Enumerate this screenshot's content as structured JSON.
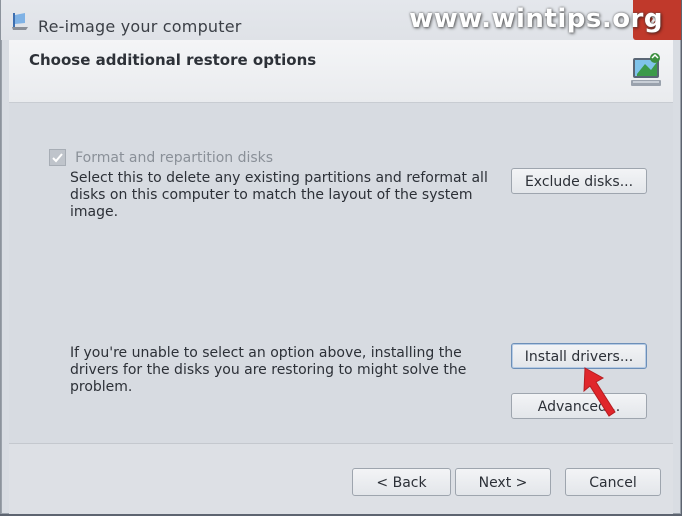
{
  "window": {
    "title": "Re-image your computer",
    "watermark": "www.wintips.org",
    "close_glyph": "x"
  },
  "header": {
    "title": "Choose additional restore options",
    "icon": "computer-restore-icon"
  },
  "options": {
    "format": {
      "checkbox_label": "Format and repartition disks",
      "checked": true,
      "enabled": false,
      "description": "Select this to delete any existing partitions and reformat all disks on this computer to match the layout of the system image.",
      "button_label": "Exclude disks..."
    },
    "drivers": {
      "description": "If you're unable to select an option above, installing the drivers for the disks you are restoring to might solve the problem.",
      "button_label": "Install drivers..."
    },
    "advanced_label": "Advanced..."
  },
  "footer": {
    "back_label": "< Back",
    "next_label": "Next >",
    "cancel_label": "Cancel"
  },
  "colors": {
    "annotation_arrow": "#e0262b",
    "close_button": "#c0392b"
  }
}
